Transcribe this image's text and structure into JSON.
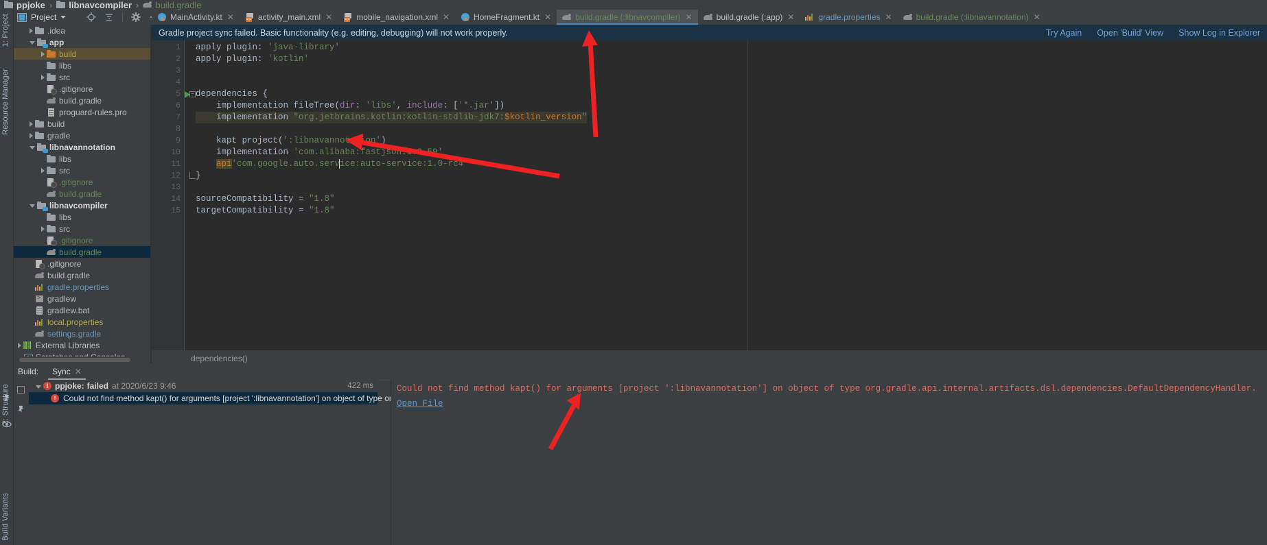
{
  "breadcrumb": {
    "project": "ppjoke",
    "module": "libnavcompiler",
    "file": "build.gradle",
    "sep": "›"
  },
  "left_strip": {
    "project_label": "1: Project",
    "resource_label": "Resource Manager",
    "structure_label": "2: Structure",
    "build_variants_label": "Build Variants"
  },
  "tool_window": {
    "title": "Project",
    "icons": [
      "locate-icon",
      "collapse-all-icon",
      "settings-gear-icon",
      "hide-icon"
    ]
  },
  "tree": [
    {
      "label": ".idea",
      "indent": 1,
      "arrow": "closed",
      "icon": "folder",
      "style": "gray",
      "sel": "none"
    },
    {
      "label": "app",
      "indent": 1,
      "arrow": "open",
      "icon": "folder-module",
      "style": "bold",
      "sel": "none"
    },
    {
      "label": "build",
      "indent": 2,
      "arrow": "closed",
      "icon": "folder-orange",
      "style": "yellow",
      "sel": "brown"
    },
    {
      "label": "libs",
      "indent": 2,
      "arrow": "none",
      "icon": "folder",
      "style": "gray",
      "sel": "none"
    },
    {
      "label": "src",
      "indent": 2,
      "arrow": "closed",
      "icon": "folder",
      "style": "gray",
      "sel": "none"
    },
    {
      "label": ".gitignore",
      "indent": 2,
      "arrow": "none",
      "icon": "gitignore",
      "style": "gray",
      "sel": "none"
    },
    {
      "label": "build.gradle",
      "indent": 2,
      "arrow": "none",
      "icon": "gradle",
      "style": "gray",
      "sel": "none"
    },
    {
      "label": "proguard-rules.pro",
      "indent": 2,
      "arrow": "none",
      "icon": "file",
      "style": "gray",
      "sel": "none"
    },
    {
      "label": "build",
      "indent": 1,
      "arrow": "closed",
      "icon": "folder",
      "style": "gray",
      "sel": "none"
    },
    {
      "label": "gradle",
      "indent": 1,
      "arrow": "closed",
      "icon": "folder",
      "style": "gray",
      "sel": "none"
    },
    {
      "label": "libnavannotation",
      "indent": 1,
      "arrow": "open",
      "icon": "folder-module",
      "style": "bold",
      "sel": "none"
    },
    {
      "label": "libs",
      "indent": 2,
      "arrow": "none",
      "icon": "folder",
      "style": "gray",
      "sel": "none"
    },
    {
      "label": "src",
      "indent": 2,
      "arrow": "closed",
      "icon": "folder",
      "style": "gray",
      "sel": "none"
    },
    {
      "label": ".gitignore",
      "indent": 2,
      "arrow": "none",
      "icon": "gitignore",
      "style": "green",
      "sel": "none"
    },
    {
      "label": "build.gradle",
      "indent": 2,
      "arrow": "none",
      "icon": "gradle",
      "style": "green",
      "sel": "none"
    },
    {
      "label": "libnavcompiler",
      "indent": 1,
      "arrow": "open",
      "icon": "folder-module",
      "style": "bold",
      "sel": "none"
    },
    {
      "label": "libs",
      "indent": 2,
      "arrow": "none",
      "icon": "folder",
      "style": "gray",
      "sel": "none"
    },
    {
      "label": "src",
      "indent": 2,
      "arrow": "closed",
      "icon": "folder",
      "style": "gray",
      "sel": "none"
    },
    {
      "label": ".gitignore",
      "indent": 2,
      "arrow": "none",
      "icon": "gitignore",
      "style": "green",
      "sel": "none"
    },
    {
      "label": "build.gradle",
      "indent": 2,
      "arrow": "none",
      "icon": "gradle",
      "style": "green",
      "sel": "blue"
    },
    {
      "label": ".gitignore",
      "indent": 1,
      "arrow": "none",
      "icon": "gitignore",
      "style": "gray",
      "sel": "none"
    },
    {
      "label": "build.gradle",
      "indent": 1,
      "arrow": "none",
      "icon": "gradle",
      "style": "gray",
      "sel": "none"
    },
    {
      "label": "gradle.properties",
      "indent": 1,
      "arrow": "none",
      "icon": "properties",
      "style": "blue",
      "sel": "none"
    },
    {
      "label": "gradlew",
      "indent": 1,
      "arrow": "none",
      "icon": "shell",
      "style": "gray",
      "sel": "none"
    },
    {
      "label": "gradlew.bat",
      "indent": 1,
      "arrow": "none",
      "icon": "file",
      "style": "gray",
      "sel": "none"
    },
    {
      "label": "local.properties",
      "indent": 1,
      "arrow": "none",
      "icon": "properties",
      "style": "yellow",
      "sel": "none"
    },
    {
      "label": "settings.gradle",
      "indent": 1,
      "arrow": "none",
      "icon": "gradle",
      "style": "blue",
      "sel": "none"
    },
    {
      "label": "External Libraries",
      "indent": 0,
      "arrow": "closed",
      "icon": "external-lib",
      "style": "gray",
      "sel": "none"
    },
    {
      "label": "Scratches and Consoles",
      "indent": 0,
      "arrow": "none",
      "icon": "scratch",
      "style": "gray",
      "sel": "none"
    }
  ],
  "tabs": [
    {
      "label": "MainActivity.kt",
      "icon": "kotlin-file-icon",
      "active": false,
      "color": "gray"
    },
    {
      "label": "activity_main.xml",
      "icon": "xml-file-icon",
      "active": false,
      "color": "gray"
    },
    {
      "label": "mobile_navigation.xml",
      "icon": "xml-file-icon",
      "active": false,
      "color": "gray"
    },
    {
      "label": "HomeFragment.kt",
      "icon": "kotlin-file-icon",
      "active": false,
      "color": "gray"
    },
    {
      "label": "build.gradle (:libnavcompiler)",
      "icon": "gradle-file-icon",
      "active": true,
      "color": "green"
    },
    {
      "label": "build.gradle (:app)",
      "icon": "gradle-file-icon",
      "active": false,
      "color": "gray"
    },
    {
      "label": "gradle.properties",
      "icon": "properties-file-icon",
      "active": false,
      "color": "blue"
    },
    {
      "label": "build.gradle (:libnavannotation)",
      "icon": "gradle-file-icon",
      "active": false,
      "color": "green"
    }
  ],
  "banner": {
    "message": "Gradle project sync failed. Basic functionality (e.g. editing, debugging) will not work properly.",
    "actions": [
      "Try Again",
      "Open 'Build' View",
      "Show Log in Explorer"
    ]
  },
  "editor": {
    "lines": [
      {
        "n": "1",
        "segments": [
          {
            "t": "apply plugin: ",
            "c": "plain"
          },
          {
            "t": "'java-library'",
            "c": "str"
          }
        ]
      },
      {
        "n": "2",
        "segments": [
          {
            "t": "apply plugin: ",
            "c": "plain"
          },
          {
            "t": "'kotlin'",
            "c": "str"
          }
        ]
      },
      {
        "n": "3",
        "segments": []
      },
      {
        "n": "4",
        "segments": []
      },
      {
        "n": "5",
        "segments": [
          {
            "t": "dependencies {",
            "c": "plain"
          }
        ]
      },
      {
        "n": "6",
        "segments": [
          {
            "t": "    implementation fileTree(",
            "c": "plain"
          },
          {
            "t": "dir",
            "c": "param"
          },
          {
            "t": ": ",
            "c": "plain"
          },
          {
            "t": "'libs'",
            "c": "str"
          },
          {
            "t": ", ",
            "c": "plain"
          },
          {
            "t": "include",
            "c": "param"
          },
          {
            "t": ": [",
            "c": "plain"
          },
          {
            "t": "'*.jar'",
            "c": "str"
          },
          {
            "t": "])",
            "c": "plain"
          }
        ]
      },
      {
        "n": "7",
        "segments": [
          {
            "t": "    implementation ",
            "c": "plain"
          },
          {
            "t": "\"org.jetbrains.kotlin:kotlin-stdlib-jdk7:",
            "c": "str"
          },
          {
            "t": "$kotlin_version",
            "c": "kw"
          },
          {
            "t": "\"",
            "c": "str"
          }
        ]
      },
      {
        "n": "8",
        "segments": []
      },
      {
        "n": "9",
        "segments": [
          {
            "t": "    kapt project(",
            "c": "plain"
          },
          {
            "t": "':libnavannotation'",
            "c": "str"
          },
          {
            "t": ")",
            "c": "plain"
          }
        ]
      },
      {
        "n": "10",
        "segments": [
          {
            "t": "    implementation ",
            "c": "plain"
          },
          {
            "t": "'com.alibaba:fastjson:1.2.59'",
            "c": "str"
          }
        ]
      },
      {
        "n": "11",
        "segments": [
          {
            "t": "    api ",
            "c": "apihl"
          },
          {
            "t": "'com.google.auto.service:auto-service:1.0-rc4'",
            "c": "str"
          }
        ]
      },
      {
        "n": "12",
        "segments": [
          {
            "t": "}",
            "c": "plain"
          }
        ]
      },
      {
        "n": "13",
        "segments": []
      },
      {
        "n": "14",
        "segments": [
          {
            "t": "sourceCompatibility = ",
            "c": "plain"
          },
          {
            "t": "\"1.8\"",
            "c": "str"
          }
        ]
      },
      {
        "n": "15",
        "segments": [
          {
            "t": "targetCompatibility = ",
            "c": "plain"
          },
          {
            "t": "\"1.8\"",
            "c": "str"
          }
        ]
      }
    ],
    "breadcrumb": "dependencies()"
  },
  "build": {
    "label": "Build:",
    "tab": "Sync",
    "root_name": "ppjoke:",
    "root_status": "failed",
    "root_at": "at 2020/6/23 9:46",
    "duration": "422 ms",
    "child_message": "Could not find method kapt() for arguments [project ':libnavannotation'] on object of type or",
    "detail": "Could not find method kapt() for arguments [project ':libnavannotation'] on object of type org.gradle.api.internal.artifacts.dsl.dependencies.DefaultDependencyHandler.",
    "open_file_link": "Open File"
  },
  "colors": {
    "accent_blue": "#4a88c7",
    "error_red": "#d1453b",
    "string_green": "#6a8759",
    "keyword_orange": "#cc7832",
    "banner_bg": "#1b3245",
    "annotation_arrow": "#ee2222"
  }
}
